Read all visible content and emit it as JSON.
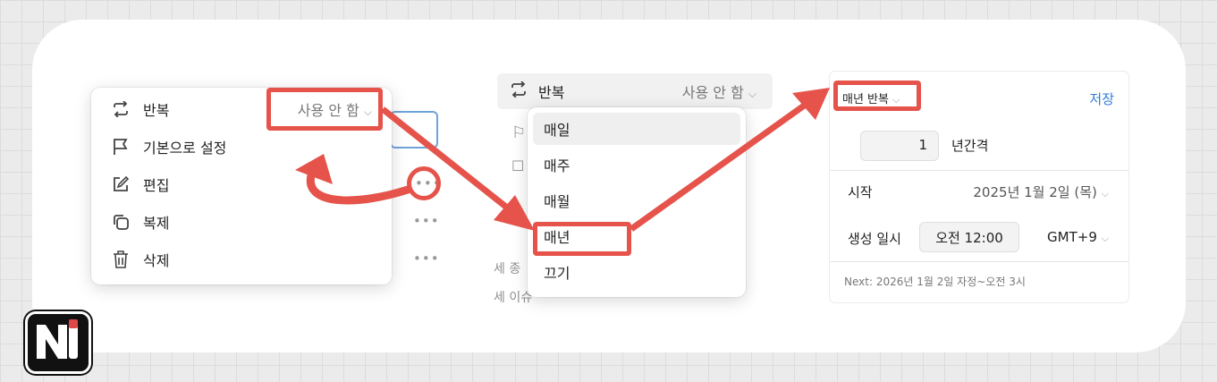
{
  "panel1": {
    "background_hints": [
      "세 종",
      "세 이슈"
    ],
    "menu": [
      {
        "icon": "repeat-icon",
        "label": "반복",
        "value": "사용 안 함"
      },
      {
        "icon": "flag-icon",
        "label": "기본으로 설정"
      },
      {
        "icon": "edit-icon",
        "label": "편집"
      },
      {
        "icon": "duplicate-icon",
        "label": "복제"
      },
      {
        "icon": "trash-icon",
        "label": "삭제"
      }
    ],
    "more_glyph": "•••"
  },
  "panel2": {
    "header": {
      "icon": "repeat-icon",
      "label": "반복",
      "value": "사용 안 함"
    },
    "options": [
      "매일",
      "매주",
      "매월",
      "매년",
      "끄기"
    ],
    "selected": "매년"
  },
  "panel3": {
    "frequency": "매년 반복",
    "save": "저장",
    "interval_value": "1",
    "interval_unit": "년간격",
    "start_label": "시작",
    "start_value": "2025년 1월 2일 (목)",
    "created_label": "생성 일시",
    "created_time": "오전 12:00",
    "timezone": "GMT+9",
    "next": "Next: 2026년 1월 2일 자정~오전 3시"
  },
  "colors": {
    "accent": "#e5534b",
    "link": "#2f7bd8"
  }
}
